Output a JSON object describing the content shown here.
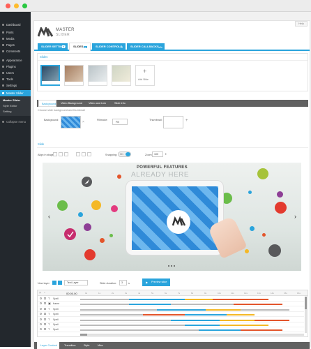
{
  "window": {
    "dots": [
      "#ff5f57",
      "#febc2e",
      "#28c840"
    ]
  },
  "sidebar": {
    "items": [
      {
        "label": "Dashboard"
      },
      {
        "label": "Posts"
      },
      {
        "label": "Media"
      },
      {
        "label": "Pages"
      },
      {
        "label": "Comments"
      },
      {
        "label": "Appearance"
      },
      {
        "label": "Plugins"
      },
      {
        "label": "Users"
      },
      {
        "label": "Tools"
      },
      {
        "label": "Settings"
      }
    ],
    "active": "Master Slider",
    "submenu": [
      "Master Slider",
      "Style Editor",
      "Setting"
    ],
    "collapse": "Collapse menu"
  },
  "header": {
    "logo_line1": "MASTER",
    "logo_line2": "SLIDER",
    "help": "Help"
  },
  "tabs": [
    {
      "label": "SLIDER SETTINGS"
    },
    {
      "label": "SLIDES"
    },
    {
      "label": "SLIDER CONTROLS"
    },
    {
      "label": "SLIDER CALLBACKS"
    }
  ],
  "slides": {
    "title": "Slides",
    "add_label": "Add Slide"
  },
  "slide_tabs": [
    "Background",
    "Video Background",
    "Video and Link",
    "Slide Info"
  ],
  "background": {
    "hint": "Choose slide background and thumbnail",
    "bg_label": "Background:",
    "fill_label": "Fillmode:",
    "fill_value": "Fill",
    "thumb_label": "Thumbnail:"
  },
  "stage": {
    "title": "Slide",
    "align_label": "Align in stage:",
    "snapping_label": "Snapping:",
    "snapping_value": "On",
    "zoom_label": "Zoom:",
    "zoom_value": "100",
    "heading1": "POWERFUL FEATURES",
    "heading2": "ALREADY HERE"
  },
  "timeline": {
    "new_layer_label": "New layer",
    "layer_type": "Text Layer",
    "duration_label": "Slide duration:",
    "duration_value": "3",
    "duration_unit": "s",
    "preview_label": "Preview slide",
    "time_display": "00:00.00",
    "ticks": [
      "0s",
      "1s",
      "2s",
      "3s",
      "4s",
      "5s",
      "6s",
      "7s",
      "8s",
      "9s",
      "10s",
      "11s",
      "12s",
      "13s",
      "14s",
      "15s",
      "16s"
    ],
    "layers": [
      {
        "name": "Spell"
      },
      {
        "name": "frame"
      },
      {
        "name": "Spell"
      },
      {
        "name": "Spell"
      },
      {
        "name": "Spell"
      },
      {
        "name": "Spell"
      },
      {
        "name": "Spell"
      }
    ]
  },
  "bottom_tabs": [
    "Layer Content",
    "Transition",
    "Style",
    "Misc"
  ]
}
